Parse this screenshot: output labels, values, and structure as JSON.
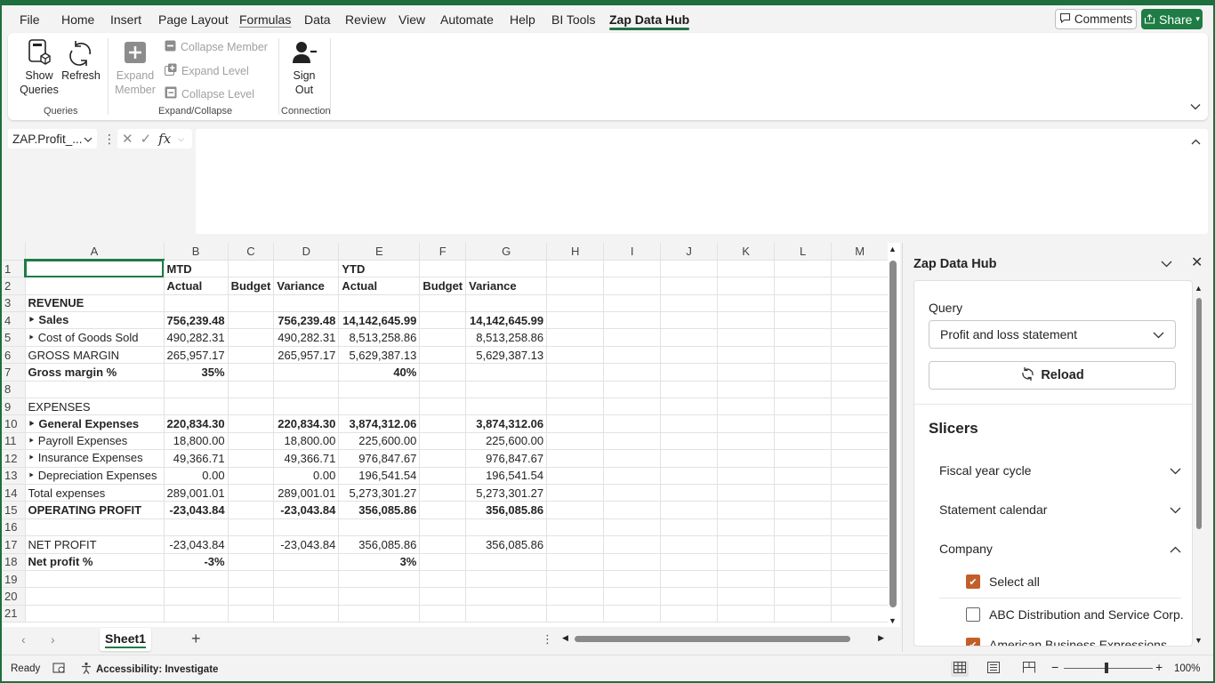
{
  "menu": {
    "items": [
      "File",
      "Home",
      "Insert",
      "Page Layout",
      "Formulas",
      "Data",
      "Review",
      "View",
      "Automate",
      "Help",
      "BI Tools",
      "Zap Data Hub"
    ],
    "active": "Zap Data Hub",
    "comments_label": "Comments",
    "share_label": "Share"
  },
  "ribbon": {
    "show_queries_label": "Show Queries",
    "refresh_label": "Refresh",
    "expand_member_label": "Expand Member",
    "collapse_member_label": "Collapse Member",
    "expand_level_label": "Expand Level",
    "collapse_level_label": "Collapse Level",
    "sign_out_label": "Sign Out",
    "group_queries": "Queries",
    "group_expand_collapse": "Expand/Collapse",
    "group_connection": "Connection"
  },
  "formula_bar": {
    "name_box": "ZAP.Profit_...",
    "fx_label": "fx",
    "formula": ""
  },
  "grid": {
    "columns": [
      "A",
      "B",
      "C",
      "D",
      "E",
      "F",
      "G",
      "H",
      "I",
      "J",
      "K",
      "L",
      "M"
    ],
    "rows": [
      [
        "",
        "MTD",
        "",
        "",
        "YTD",
        "",
        ""
      ],
      [
        "",
        "Actual",
        "Budget",
        "Variance",
        "Actual",
        "Budget",
        "Variance"
      ],
      [
        "REVENUE",
        "",
        "",
        "",
        "",
        "",
        ""
      ],
      [
        "‣ Sales",
        "756,239.48",
        "",
        "756,239.48",
        "14,142,645.99",
        "",
        "14,142,645.99"
      ],
      [
        "‣ Cost of Goods Sold",
        "490,282.31",
        "",
        "490,282.31",
        "8,513,258.86",
        "",
        "8,513,258.86"
      ],
      [
        "GROSS MARGIN",
        "265,957.17",
        "",
        "265,957.17",
        "5,629,387.13",
        "",
        "5,629,387.13"
      ],
      [
        "Gross margin %",
        "35%",
        "",
        "",
        "40%",
        "",
        ""
      ],
      [
        "",
        "",
        "",
        "",
        "",
        "",
        ""
      ],
      [
        "EXPENSES",
        "",
        "",
        "",
        "",
        "",
        ""
      ],
      [
        "‣ General Expenses",
        "220,834.30",
        "",
        "220,834.30",
        "3,874,312.06",
        "",
        "3,874,312.06"
      ],
      [
        "‣ Payroll Expenses",
        "18,800.00",
        "",
        "18,800.00",
        "225,600.00",
        "",
        "225,600.00"
      ],
      [
        "‣ Insurance Expenses",
        "49,366.71",
        "",
        "49,366.71",
        "976,847.67",
        "",
        "976,847.67"
      ],
      [
        "‣ Depreciation Expenses",
        "0.00",
        "",
        "0.00",
        "196,541.54",
        "",
        "196,541.54"
      ],
      [
        "Total expenses",
        "289,001.01",
        "",
        "289,001.01",
        "5,273,301.27",
        "",
        "5,273,301.27"
      ],
      [
        "OPERATING PROFIT",
        "-23,043.84",
        "",
        "-23,043.84",
        "356,085.86",
        "",
        "356,085.86"
      ],
      [
        "",
        "",
        "",
        "",
        "",
        "",
        ""
      ],
      [
        "NET PROFIT",
        "-23,043.84",
        "",
        "-23,043.84",
        "356,085.86",
        "",
        "356,085.86"
      ],
      [
        "Net profit %",
        "-3%",
        "",
        "",
        "3%",
        "",
        ""
      ],
      [
        "",
        "",
        "",
        "",
        "",
        "",
        ""
      ],
      [
        "",
        "",
        "",
        "",
        "",
        "",
        ""
      ],
      [
        "",
        "",
        "",
        "",
        "",
        "",
        ""
      ]
    ],
    "bold_rows": [
      1,
      2,
      3,
      6,
      9,
      14,
      15,
      17
    ]
  },
  "sheet_tabs": {
    "active": "Sheet1"
  },
  "status": {
    "ready": "Ready",
    "accessibility": "Accessibility: Investigate",
    "zoom": "100%"
  },
  "pane": {
    "title": "Zap Data Hub",
    "query_label": "Query",
    "query_value": "Profit and loss statement",
    "reload_label": "Reload",
    "slicers_title": "Slicers",
    "slicers": [
      "Fiscal year cycle",
      "Statement calendar",
      "Company"
    ],
    "company_options": [
      {
        "label": "Select all",
        "checked": true
      },
      {
        "label": "ABC Distribution and Service Corp.",
        "checked": false
      },
      {
        "label": "American Business Expressions",
        "checked": true
      }
    ]
  }
}
